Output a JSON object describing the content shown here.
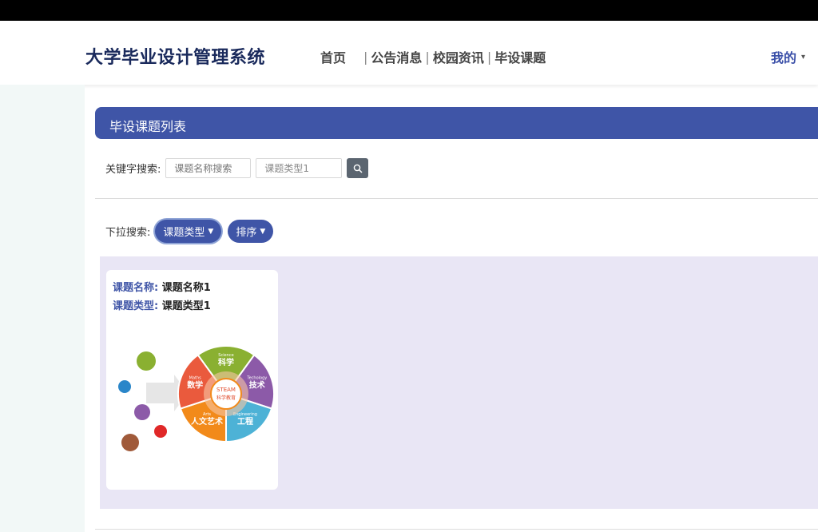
{
  "header": {
    "site_title": "大学毕业设计管理系统",
    "nav": [
      "首页",
      "公告消息",
      "校园资讯",
      "毕设课题"
    ],
    "user_menu": "我的"
  },
  "panel": {
    "title": "毕设课题列表"
  },
  "search": {
    "label": "关键字搜索:",
    "name_placeholder": "课题名称搜索",
    "type_value": "课题类型1"
  },
  "filters": {
    "label": "下拉搜索:",
    "type_label": "课题类型",
    "sort_label": "排序"
  },
  "cards": [
    {
      "name_key": "课题名称:",
      "name_value": "课题名称1",
      "type_key": "课题类型:",
      "type_value": "课题类型1",
      "image": {
        "center_en": "STEAM",
        "center_cn": "科学教育",
        "segments": [
          {
            "en": "Science",
            "cn": "科学",
            "color": "#8ab031"
          },
          {
            "en": "Techology",
            "cn": "技术",
            "color": "#8c5aa8"
          },
          {
            "en": "Engineering",
            "cn": "工程",
            "color": "#4db2d6"
          },
          {
            "en": "Arts",
            "cn": "人文艺术",
            "color": "#f28a1a"
          },
          {
            "en": "Maths",
            "cn": "数学",
            "color": "#ea5a3d"
          }
        ]
      }
    }
  ],
  "colors": {
    "primary": "#3f55a7",
    "content_bg": "#e9e6f5",
    "side_bg": "#f2f8f7"
  }
}
